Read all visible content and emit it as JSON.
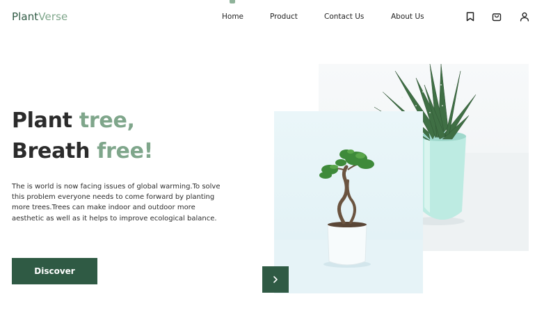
{
  "header": {
    "logo": {
      "part1": "Plant",
      "part2": "Verse"
    },
    "nav": [
      "Home",
      "Product",
      "Contact Us",
      "About Us"
    ],
    "icons": [
      "bookmark-icon",
      "shopping-bag-icon",
      "user-icon"
    ]
  },
  "hero": {
    "line1": {
      "text": "Plant ",
      "accent": "tree,"
    },
    "line2": {
      "text": "Breath ",
      "accent": "free!"
    },
    "description": "The is world is now facing issues of global warming.To solve this problem everyone needs to come forward by planting more trees.Trees can make indoor and outdoor more aesthetic as well as it helps to improve ecological balance.",
    "cta": "Discover"
  },
  "gallery": {
    "images": [
      "aloe-plant-in-mint-pot",
      "bonsai-tree-in-white-pot"
    ],
    "next_icon": "chevron-right-icon"
  },
  "colors": {
    "brand": "#2f5a44",
    "accent": "#7fa68b",
    "text": "#2b2b2b"
  }
}
